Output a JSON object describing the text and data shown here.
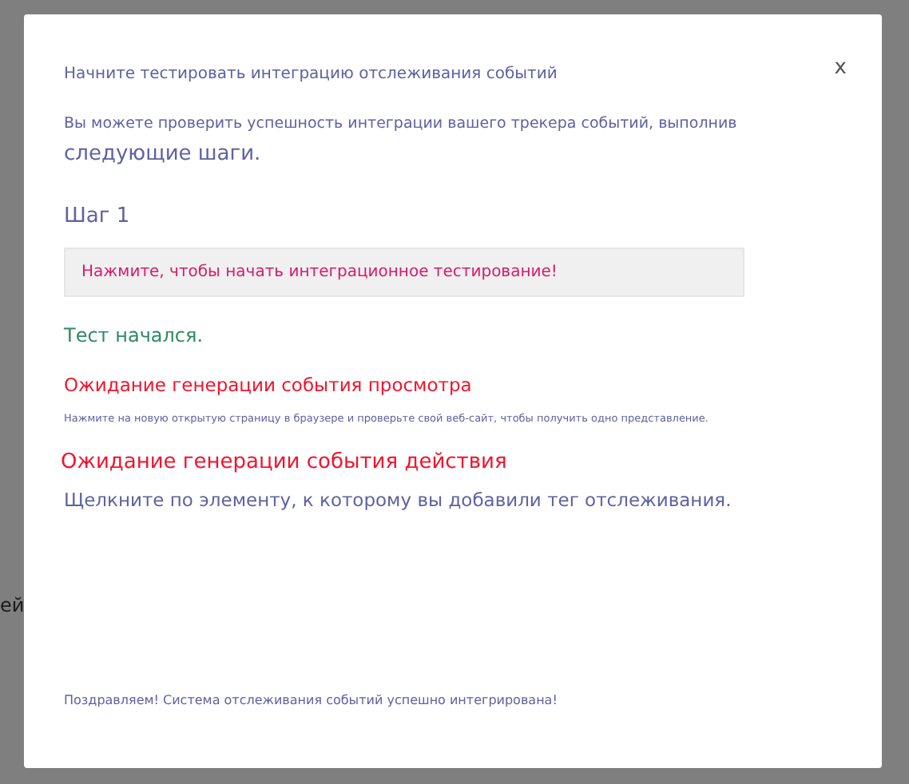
{
  "background": {
    "text": "ей"
  },
  "modal": {
    "close": "x",
    "title": "Начните тестировать интеграцию отслеживания событий",
    "intro_line_1": "Вы можете проверить успешность интеграции вашего трекера событий, выполнив",
    "intro_line_2": "следующие шаги.",
    "step_heading": "Шаг 1",
    "start_button": "Нажмите, чтобы начать интеграционное тестирование!",
    "status": "Тест начался.",
    "view_stage": {
      "heading": "Ожидание генерации события просмотра",
      "hint": "Нажмите на новую открытую страницу в браузере и проверьте свой веб-сайт, чтобы получить одно представление."
    },
    "action_stage": {
      "heading": "Ожидание генерации события действия",
      "hint": "Щелкните по элементу, к которому вы добавили тег отслеживания."
    },
    "footer": "Поздравляем! Система отслеживания событий успешно интегрирована!"
  }
}
